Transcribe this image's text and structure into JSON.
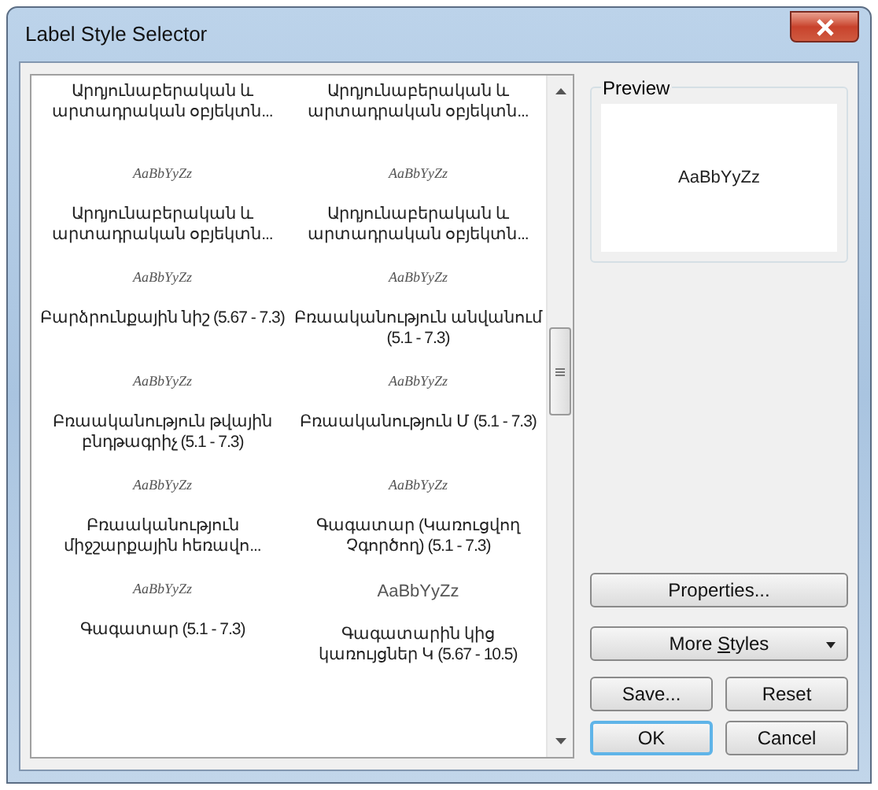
{
  "window": {
    "title": "Label Style Selector"
  },
  "style_list": {
    "items": [
      {
        "name": "Արդյունաբերական և արտադրական օբյեկտն..."
      },
      {
        "name": "Արդյունաբերական և արտադրական օբյեկտն..."
      },
      {
        "sample": "AaBbYyZz",
        "italic": true,
        "name": "Արդյունաբերական և արտադրական օբյեկտն..."
      },
      {
        "sample": "AaBbYyZz",
        "italic": true,
        "name": "Արդյունաբերական և արտադրական օբյեկտն..."
      },
      {
        "sample": "AaBbYyZz",
        "italic": true,
        "name": "Բարձրունքային նիշ (5.67 - 7.3)"
      },
      {
        "sample": "AaBbYyZz",
        "italic": true,
        "name": "Բռաականություն անվանում (5.1 - 7.3)"
      },
      {
        "sample": "AaBbYyZz",
        "italic": true,
        "name": "Բռաականություն թվային բնդթագրիչ (5.1 - 7.3)"
      },
      {
        "sample": "AaBbYyZz",
        "italic": true,
        "name": "Բռաականություն Մ (5.1 - 7.3)"
      },
      {
        "sample": "AaBbYyZz",
        "italic": true,
        "name": "Բռաականություն միջշարքային հեռավո..."
      },
      {
        "sample": "AaBbYyZz",
        "italic": true,
        "name": "Գագատար (Կառուցվող Չգործող) (5.1 - 7.3)"
      },
      {
        "sample": "AaBbYyZz",
        "italic": true,
        "name": "Գագատար (5.1 - 7.3)"
      },
      {
        "sample": "AaBbYyZz",
        "italic": false,
        "name": "Գագատարին կից կառույցներ Կ (5.67 - 10.5)"
      }
    ]
  },
  "preview": {
    "title": "Preview",
    "sample": "AaBbYyZz"
  },
  "buttons": [
    {
      "label": "Properties...",
      "kind": "wide",
      "default": false
    },
    {
      "label_before": "More ",
      "access_key": "S",
      "label_after": "tyles",
      "kind": "dropdown",
      "default": false
    },
    {
      "label": "Save...",
      "kind": "half",
      "default": false
    },
    {
      "label": "Reset",
      "kind": "half",
      "default": false
    },
    {
      "label": "OK",
      "kind": "half",
      "default": true
    },
    {
      "label": "Cancel",
      "kind": "half",
      "default": false
    }
  ]
}
